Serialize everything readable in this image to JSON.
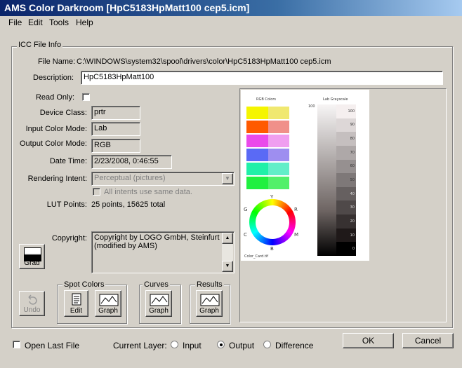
{
  "window": {
    "title": "AMS Color Darkroom [HpC5183HpMatt100 cep5.icm]"
  },
  "menu": [
    "File",
    "Edit",
    "Tools",
    "Help"
  ],
  "icc": {
    "group_label": "ICC File Info",
    "file_name_label": "File Name:",
    "file_name": "C:\\WINDOWS\\system32\\spool\\drivers\\color\\HpC5183HpMatt100 cep5.icm",
    "description_label": "Description:",
    "description": "HpC5183HpMatt100",
    "read_only_label": "Read Only:",
    "device_class_label": "Device Class:",
    "device_class": "prtr",
    "input_mode_label": "Input Color Mode:",
    "input_mode": "Lab",
    "output_mode_label": "Output Color Mode:",
    "output_mode": "RGB",
    "date_time_label": "Date Time:",
    "date_time": "2/23/2008, 0:46:55",
    "rendering_intent_label": "Rendering Intent:",
    "rendering_intent": "Perceptual (pictures)",
    "all_intents_label": "All intents use same data.",
    "lut_points_label": "LUT Points:",
    "lut_points": "25 points, 15625 total",
    "copyright_label": "Copyright:",
    "copyright_text": "Copyright by LOGO GmbH, Steinfurt (modified by AMS)"
  },
  "preview": {
    "rgb_title": "RGB Colors",
    "gray_title": "Lab Grayscale",
    "wheel_labels": {
      "Y": "Y",
      "R": "R",
      "M": "M",
      "B": "B",
      "C": "C",
      "G": "G"
    },
    "caption": "Color_Card.tif",
    "rgb_swatches": [
      {
        "color": "#f5f500",
        "color2": "#f0e870"
      },
      {
        "color": "#ff5a00",
        "color2": "#f0908a"
      },
      {
        "color": "#ea4aea",
        "color2": "#f09ef0"
      },
      {
        "color": "#5a6af5",
        "color2": "#9e8ef0"
      },
      {
        "color": "#20f0a8",
        "color2": "#62eec8"
      },
      {
        "color": "#20f040",
        "color2": "#52f06a"
      }
    ],
    "gray_top_label": "100",
    "gray_ticks": [
      "100",
      "90",
      "80",
      "70",
      "60",
      "50",
      "40",
      "30",
      "20",
      "10",
      "0"
    ]
  },
  "buttons": {
    "grad": "Grad",
    "undo": "Undo",
    "spot_colors_group": "Spot Colors",
    "edit": "Edit",
    "graph": "Graph",
    "curves_group": "Curves",
    "results_group": "Results",
    "ok": "OK",
    "cancel": "Cancel"
  },
  "bottom": {
    "open_last_file": "Open Last File",
    "current_layer": "Current Layer:",
    "input": "Input",
    "output": "Output",
    "difference": "Difference"
  }
}
